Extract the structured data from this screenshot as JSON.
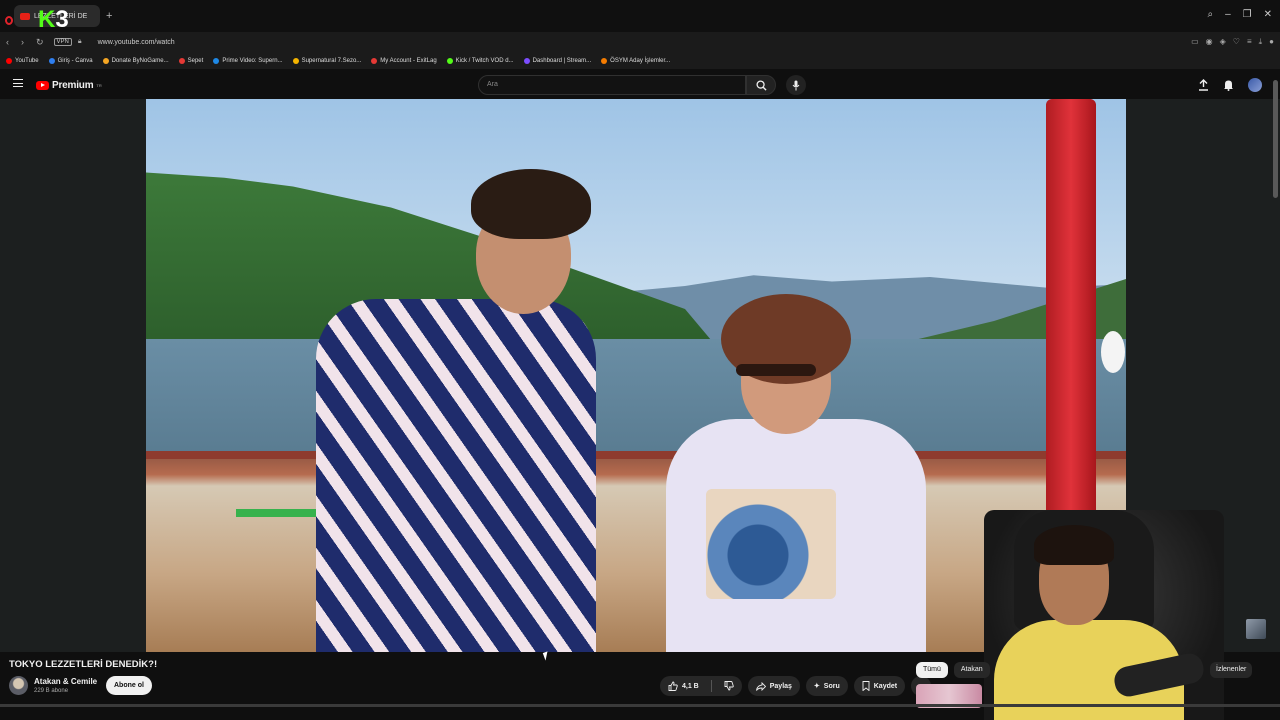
{
  "browser": {
    "tab_title": "LEZZETLERİ DE",
    "new_tab_symbol": "+",
    "url": "www.youtube.com/watch",
    "vpn_label": "VPN",
    "window_controls": [
      "search",
      "minimize",
      "restore",
      "close"
    ]
  },
  "overlay": {
    "stream_logo_k": "K",
    "stream_logo_num": "3"
  },
  "bookmarks": [
    {
      "label": "YouTube",
      "color": "#ff0000"
    },
    {
      "label": "Giriş - Canva",
      "color": "#2f7ff0"
    },
    {
      "label": "Donate ByNoGame...",
      "color": "#f5a623"
    },
    {
      "label": "Sepet",
      "color": "#e53935"
    },
    {
      "label": "Prime Video: Supern...",
      "color": "#1e88e5"
    },
    {
      "label": "Supernatural 7.Sezo...",
      "color": "#f4b400"
    },
    {
      "label": "My Account - ExitLag",
      "color": "#e53935"
    },
    {
      "label": "Kick / Twitch VOD d...",
      "color": "#53fc18"
    },
    {
      "label": "Dashboard | Stream...",
      "color": "#7c4dff"
    },
    {
      "label": "ÖSYM Aday İşlemler...",
      "color": "#f57c00"
    }
  ],
  "youtube": {
    "logo_text": "Premium",
    "logo_region": "TR",
    "search_placeholder": "Ara"
  },
  "video": {
    "title": "TOKYO LEZZETLERİ DENEDİK?!",
    "channel_name": "Atakan & Cemile",
    "subscribers": "229 B abone",
    "subscribe_label": "Abone ol",
    "like_count": "4,1 B",
    "share_label": "Paylaş",
    "ask_label": "Soru",
    "save_label": "Kaydet"
  },
  "sidebar_chips": {
    "all": "Tümü",
    "channel": "Atakan",
    "watched": "İzlenenler"
  },
  "colors": {
    "yt_red": "#ff0000",
    "background": "#0f0f0f",
    "kick_green": "#53fc18"
  }
}
